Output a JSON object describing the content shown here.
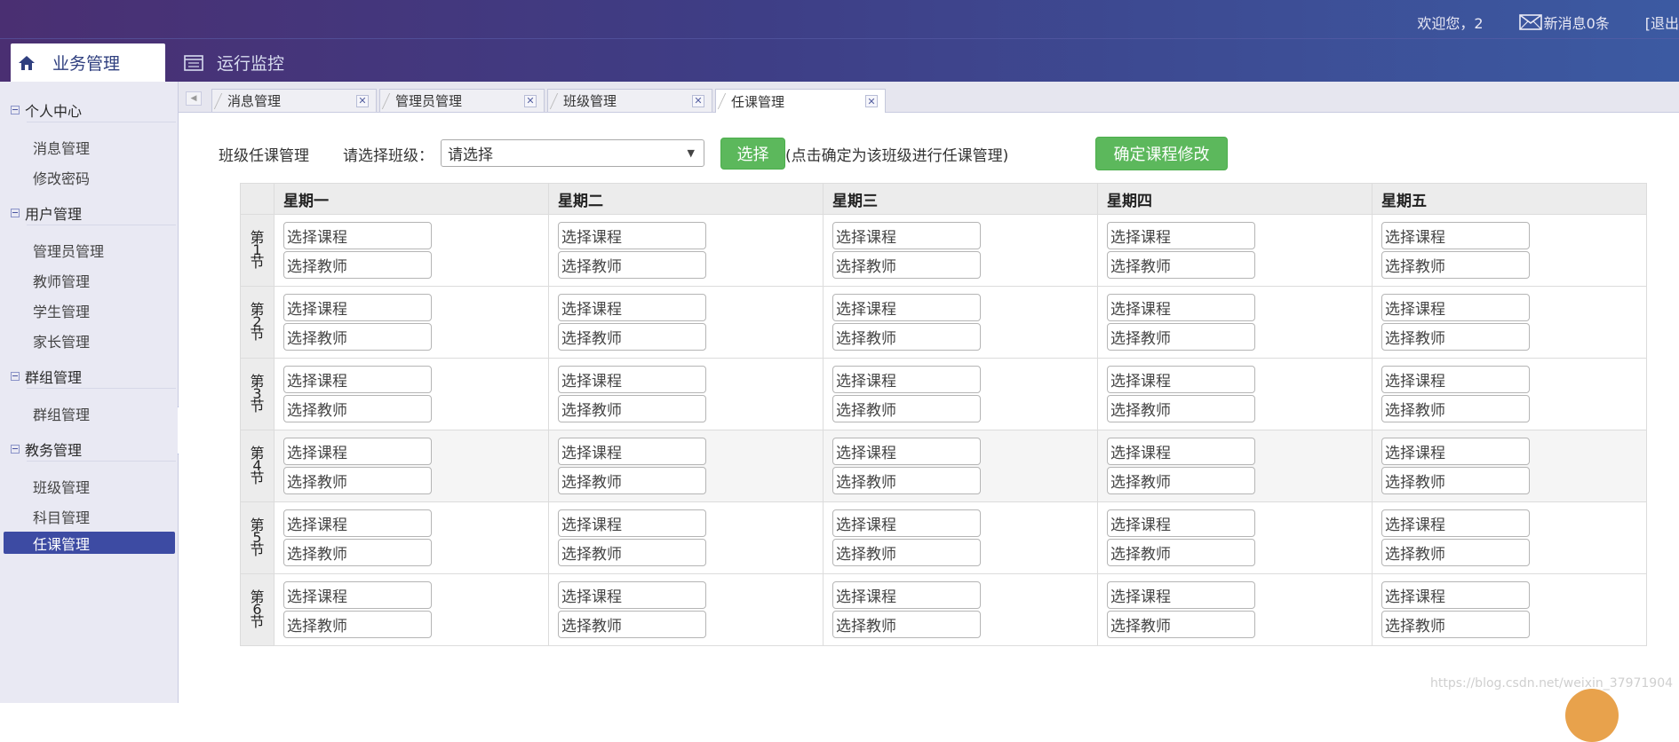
{
  "header": {
    "welcome": "欢迎您，2",
    "messages": "新消息0条",
    "logout": "[退出",
    "tabs": [
      {
        "label": "业务管理",
        "icon": "home-icon"
      },
      {
        "label": "运行监控",
        "icon": "list-icon"
      }
    ]
  },
  "sidebar": {
    "groups": [
      {
        "label": "个人中心",
        "items": [
          "消息管理",
          "修改密码"
        ]
      },
      {
        "label": "用户管理",
        "items": [
          "管理员管理",
          "教师管理",
          "学生管理",
          "家长管理"
        ]
      },
      {
        "label": "群组管理",
        "items": [
          "群组管理"
        ]
      },
      {
        "label": "教务管理",
        "items": [
          "班级管理",
          "科目管理",
          "任课管理"
        ]
      }
    ],
    "active_item": "任课管理"
  },
  "page_tabs": [
    {
      "label": "消息管理"
    },
    {
      "label": "管理员管理"
    },
    {
      "label": "班级管理"
    },
    {
      "label": "任课管理",
      "active": true
    }
  ],
  "controls": {
    "title": "班级任课管理",
    "select_label": "请选择班级：",
    "select_value": "请选择",
    "select_button": "选择",
    "hint": "(点击确定为该班级进行任课管理)",
    "confirm_button": "确定课程修改"
  },
  "timetable": {
    "days": [
      "星期一",
      "星期二",
      "星期三",
      "星期四",
      "星期五"
    ],
    "periods": [
      [
        "第",
        "1",
        "节"
      ],
      [
        "第",
        "2",
        "节"
      ],
      [
        "第",
        "3",
        "节"
      ],
      [
        "第",
        "4",
        "节"
      ],
      [
        "第",
        "5",
        "节"
      ],
      [
        "第",
        "6",
        "节"
      ]
    ],
    "course_placeholder": "选择课程",
    "teacher_placeholder": "选择教师"
  },
  "watermark": "https://blog.csdn.net/weixin_37971904",
  "colors": {
    "header_start": "#4a2f72",
    "header_end": "#3c5aa2",
    "active_nav": "#3d4ba3",
    "button_green": "#5cb85c"
  }
}
